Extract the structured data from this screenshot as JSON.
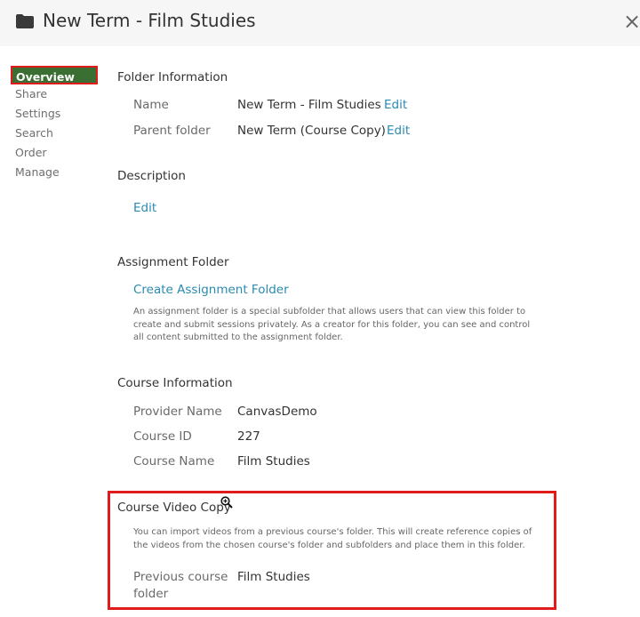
{
  "header": {
    "title": "New Term - Film Studies",
    "folder_icon": "folder-icon",
    "close_label": "×"
  },
  "nav": {
    "items": [
      {
        "label": "Overview",
        "active": true
      },
      {
        "label": "Share"
      },
      {
        "label": "Settings"
      },
      {
        "label": "Search"
      },
      {
        "label": "Order"
      },
      {
        "label": "Manage"
      }
    ]
  },
  "folder_info": {
    "title": "Folder Information",
    "name_label": "Name",
    "name_value": "New Term - Film Studies",
    "parent_label": "Parent folder",
    "parent_value": "New Term (Course Copy)",
    "edit_label": "Edit"
  },
  "description": {
    "title": "Description",
    "edit_label": "Edit"
  },
  "assignment": {
    "title": "Assignment Folder",
    "create_label": "Create Assignment Folder",
    "help_lines": [
      "An assignment folder is a special subfolder that allows users that can view this folder to",
      "create and submit sessions privately. As a creator for this folder, you can see and control",
      "all content submitted to the assignment folder."
    ]
  },
  "course_info": {
    "title": "Course Information",
    "provider_label": "Provider Name",
    "provider_value": "CanvasDemo",
    "id_label": "Course ID",
    "id_value": "227",
    "course_name_label": "Course Name",
    "course_name_value": "Film Studies"
  },
  "video_copy": {
    "title": "Course Video Copy",
    "help_lines": [
      "You can import videos from a previous course's folder. This will create reference copies of",
      "the videos from the chosen course's folder and subfolders and place them in this folder."
    ],
    "prev_label_1": "Previous course",
    "prev_label_2": "folder",
    "prev_value": "Film Studies"
  },
  "colors": {
    "accent_green": "#3b6e32",
    "link_blue": "#2a8ab0",
    "highlight_red": "#e01b1b"
  }
}
